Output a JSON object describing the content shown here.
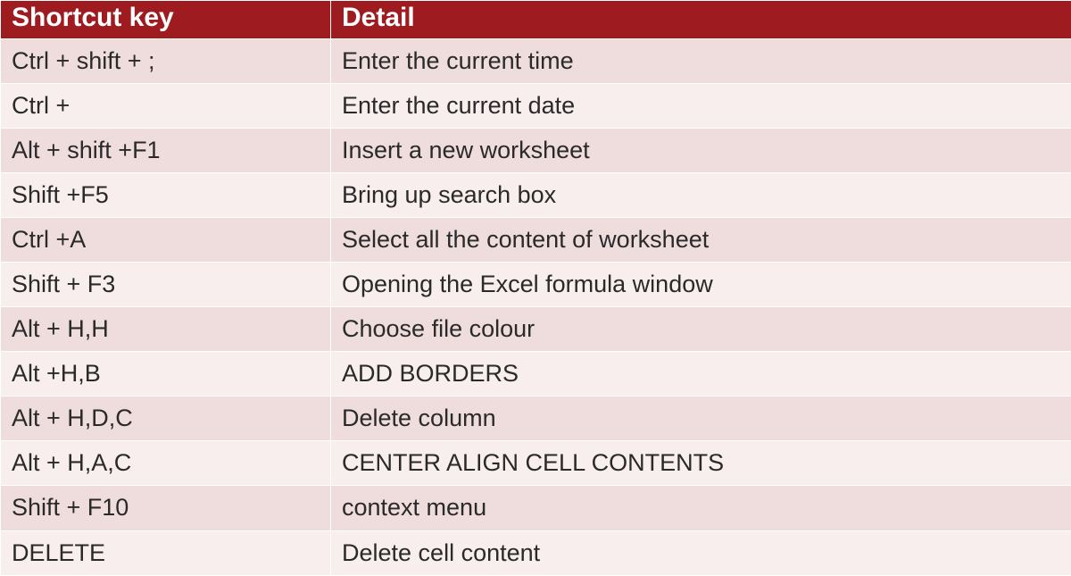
{
  "table": {
    "headers": {
      "shortcut": "Shortcut key",
      "detail": "Detail"
    },
    "rows": [
      {
        "shortcut": "Ctrl + shift + ;",
        "detail": "Enter the current time"
      },
      {
        "shortcut": "Ctrl +",
        "detail": "Enter the current date"
      },
      {
        "shortcut": "Alt + shift +F1",
        "detail": "Insert  a new worksheet"
      },
      {
        "shortcut": "Shift +F5",
        "detail": "Bring up search box"
      },
      {
        "shortcut": "Ctrl +A",
        "detail": "Select all  the content of worksheet"
      },
      {
        "shortcut": "Shift + F3",
        "detail": " Opening  the  Excel formula window"
      },
      {
        "shortcut": "Alt + H,H",
        "detail": "Choose file colour"
      },
      {
        "shortcut": "Alt +H,B",
        "detail": "ADD BORDERS"
      },
      {
        "shortcut": "Alt + H,D,C",
        "detail": "Delete column"
      },
      {
        "shortcut": "Alt + H,A,C",
        "detail": "CENTER ALIGN CELL CONTENTS"
      },
      {
        "shortcut": "Shift + F10",
        "detail": " context menu"
      },
      {
        "shortcut": "DELETE",
        "detail": "Delete cell content"
      }
    ]
  }
}
